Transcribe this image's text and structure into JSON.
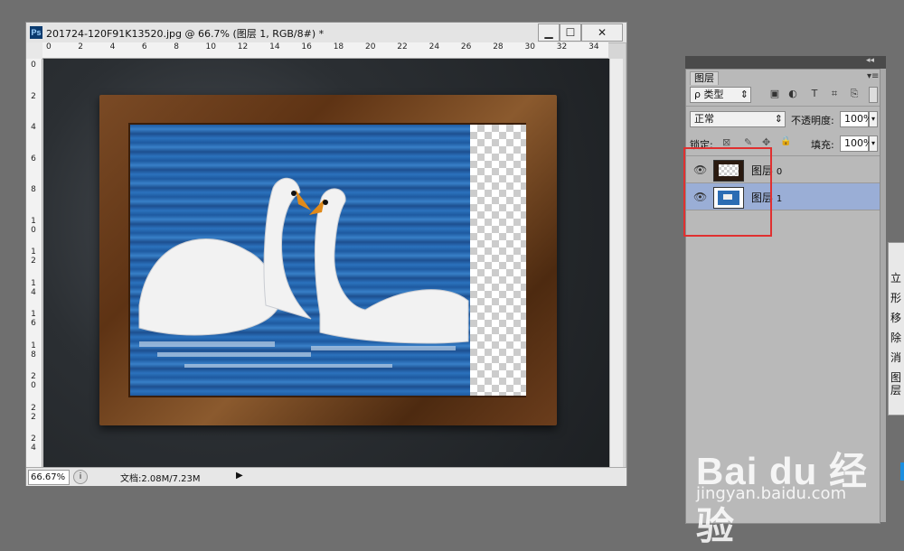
{
  "document": {
    "title": "201724-120F91K13520.jpg @ 66.7% (图层 1, RGB/8#) *",
    "app_icon": "Ps",
    "window_buttons": {
      "minimize": "▁",
      "maximize": "☐",
      "close": "✕"
    },
    "hruler_labels": [
      "0",
      "2",
      "4",
      "6",
      "8",
      "10",
      "12",
      "14",
      "16",
      "18",
      "20",
      "22",
      "24",
      "26",
      "28",
      "30",
      "32",
      "34"
    ],
    "vruler_labels": [
      "0",
      "2",
      "4",
      "6",
      "8",
      "1\n0",
      "1\n2",
      "1\n4",
      "1\n6",
      "1\n8",
      "2\n0",
      "2\n2",
      "2\n4"
    ],
    "status": {
      "zoom": "66.67%",
      "doc_info": "文档:2.08M/7.23M",
      "arrow": "▶"
    }
  },
  "layers_panel": {
    "tab_label": "图层",
    "menu_icon": "▾≡",
    "collapse_icon": "◂◂",
    "filter_label": "ρ 类型",
    "filter_icons": [
      "image-filter-icon",
      "adjustment-filter-icon",
      "type-filter-icon",
      "shape-filter-icon",
      "smart-object-filter-icon"
    ],
    "filter_glyphs": [
      "▣",
      "◐",
      "T",
      "⌗",
      "⎘"
    ],
    "blend_mode": "正常",
    "opacity_label": "不透明度:",
    "opacity_value": "100%",
    "lock_label": "锁定:",
    "lock_glyphs": [
      "⊠",
      "✎",
      "✥",
      "🔒"
    ],
    "fill_label": "填充:",
    "fill_value": "100%",
    "layers": [
      {
        "name": "图层",
        "suffix": "0",
        "visible": true,
        "selected": false
      },
      {
        "name": "图层",
        "suffix": "1",
        "visible": true,
        "selected": true
      }
    ],
    "eye_glyph": "👁",
    "highlight_color": "#e03030",
    "selected_color": "#9aaed6"
  },
  "side_panel": {
    "items": [
      "立",
      "形",
      "移",
      "除",
      "消",
      "图层"
    ]
  },
  "watermark": {
    "logo": "Bai du 经验",
    "url": "jingyan.baidu.com"
  }
}
